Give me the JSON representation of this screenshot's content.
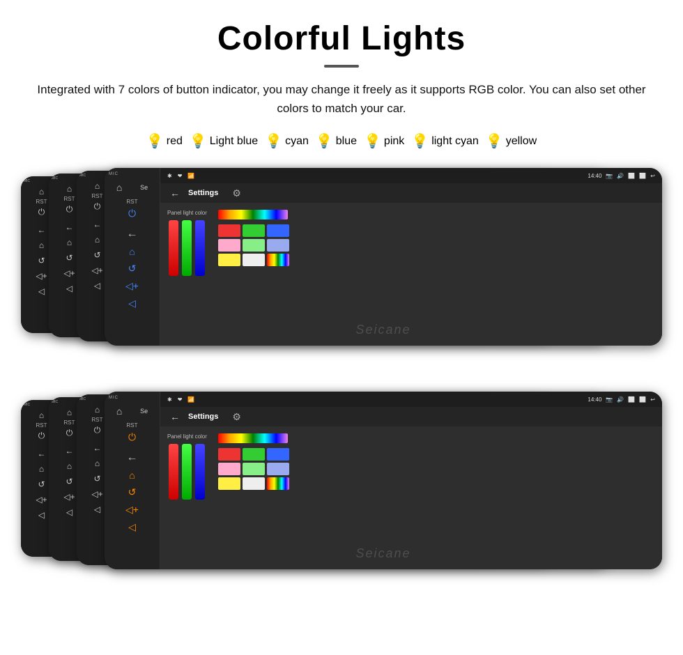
{
  "page": {
    "title": "Colorful Lights",
    "divider": true,
    "description": "Integrated with 7 colors of button indicator, you may change it freely as it supports RGB color. You can also set other colors to match your car.",
    "colors": [
      {
        "name": "red",
        "class": "bulb-red",
        "icon": "💡"
      },
      {
        "name": "Light blue",
        "class": "bulb-lightblue",
        "icon": "💡"
      },
      {
        "name": "cyan",
        "class": "bulb-cyan",
        "icon": "💡"
      },
      {
        "name": "blue",
        "class": "bulb-blue",
        "icon": "💡"
      },
      {
        "name": "pink",
        "class": "bulb-pink",
        "icon": "💡"
      },
      {
        "name": "light cyan",
        "class": "bulb-lightcyan",
        "icon": "💡"
      },
      {
        "name": "yellow",
        "class": "bulb-yellow",
        "icon": "💡"
      }
    ]
  },
  "screen": {
    "status_bar": {
      "left_icons": [
        "🔵",
        "❤",
        "📶"
      ],
      "time": "14:40",
      "right_icons": [
        "📷",
        "🔊",
        "⬜",
        "⬜",
        "↩"
      ]
    },
    "app_title": "Settings",
    "panel_light_label": "Panel light color",
    "watermark": "Seicane"
  }
}
